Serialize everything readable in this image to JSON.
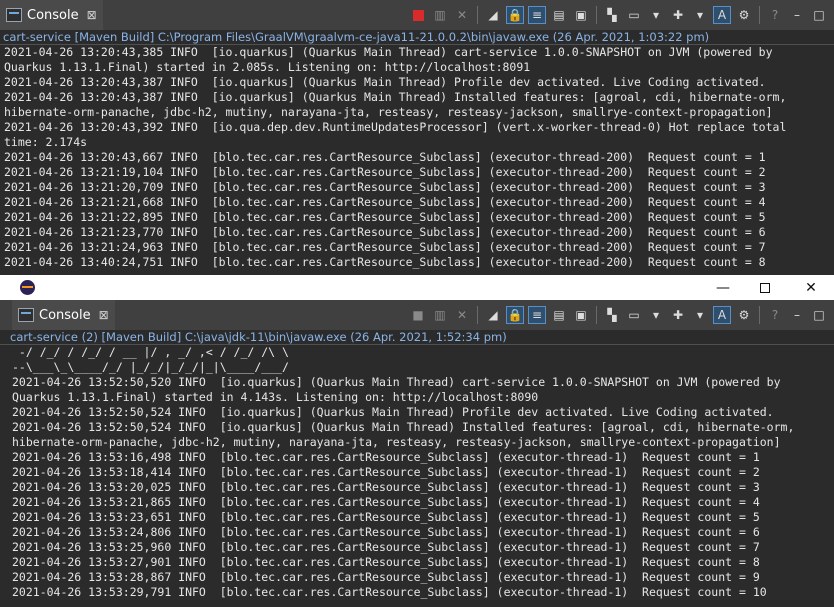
{
  "top_console": {
    "tab_label": "Console",
    "close_glyph": "⊠",
    "path": "cart-service [Maven Build] C:\\Program Files\\GraalVM\\graalvm-ce-java11-21.0.0.2\\bin\\javaw.exe  (26 Apr. 2021, 1:03:22 pm)",
    "lines": [
      "2021-04-26 13:20:43,385 INFO  [io.quarkus] (Quarkus Main Thread) cart-service 1.0.0-SNAPSHOT on JVM (powered by",
      "Quarkus 1.13.1.Final) started in 2.085s. Listening on: http://localhost:8091",
      "2021-04-26 13:20:43,387 INFO  [io.quarkus] (Quarkus Main Thread) Profile dev activated. Live Coding activated.",
      "2021-04-26 13:20:43,387 INFO  [io.quarkus] (Quarkus Main Thread) Installed features: [agroal, cdi, hibernate-orm,",
      "hibernate-orm-panache, jdbc-h2, mutiny, narayana-jta, resteasy, resteasy-jackson, smallrye-context-propagation]",
      "2021-04-26 13:20:43,392 INFO  [io.qua.dep.dev.RuntimeUpdatesProcessor] (vert.x-worker-thread-0) Hot replace total",
      "time: 2.174s",
      "2021-04-26 13:20:43,667 INFO  [blo.tec.car.res.CartResource_Subclass] (executor-thread-200)  Request count = 1",
      "2021-04-26 13:21:19,104 INFO  [blo.tec.car.res.CartResource_Subclass] (executor-thread-200)  Request count = 2",
      "2021-04-26 13:21:20,709 INFO  [blo.tec.car.res.CartResource_Subclass] (executor-thread-200)  Request count = 3",
      "2021-04-26 13:21:21,668 INFO  [blo.tec.car.res.CartResource_Subclass] (executor-thread-200)  Request count = 4",
      "2021-04-26 13:21:22,895 INFO  [blo.tec.car.res.CartResource_Subclass] (executor-thread-200)  Request count = 5",
      "2021-04-26 13:21:23,770 INFO  [blo.tec.car.res.CartResource_Subclass] (executor-thread-200)  Request count = 6",
      "2021-04-26 13:21:24,963 INFO  [blo.tec.car.res.CartResource_Subclass] (executor-thread-200)  Request count = 7",
      "2021-04-26 13:40:24,751 INFO  [blo.tec.car.res.CartResource_Subclass] (executor-thread-200)  Request count = 8"
    ]
  },
  "window_controls": {
    "minimize": "—",
    "close": "✕"
  },
  "bottom_console": {
    "tab_label": "Console",
    "close_glyph": "⊠",
    "path": "cart-service (2) [Maven Build] C:\\java\\jdk-11\\bin\\javaw.exe  (26 Apr. 2021, 1:52:34 pm)",
    "ascii_lines": [
      " -/ /_/ / /_/ / __ |/ , _/ ,< / /_/ /\\ \\",
      "--\\___\\_\\____/_/ |_/_/|_/_/|_|\\____/___/"
    ],
    "lines": [
      "2021-04-26 13:52:50,520 INFO  [io.quarkus] (Quarkus Main Thread) cart-service 1.0.0-SNAPSHOT on JVM (powered by",
      "Quarkus 1.13.1.Final) started in 4.143s. Listening on: http://localhost:8090",
      "2021-04-26 13:52:50,524 INFO  [io.quarkus] (Quarkus Main Thread) Profile dev activated. Live Coding activated.",
      "2021-04-26 13:52:50,524 INFO  [io.quarkus] (Quarkus Main Thread) Installed features: [agroal, cdi, hibernate-orm,",
      "hibernate-orm-panache, jdbc-h2, mutiny, narayana-jta, resteasy, resteasy-jackson, smallrye-context-propagation]",
      "2021-04-26 13:53:16,498 INFO  [blo.tec.car.res.CartResource_Subclass] (executor-thread-1)  Request count = 1",
      "2021-04-26 13:53:18,414 INFO  [blo.tec.car.res.CartResource_Subclass] (executor-thread-1)  Request count = 2",
      "2021-04-26 13:53:20,025 INFO  [blo.tec.car.res.CartResource_Subclass] (executor-thread-1)  Request count = 3",
      "2021-04-26 13:53:21,865 INFO  [blo.tec.car.res.CartResource_Subclass] (executor-thread-1)  Request count = 4",
      "2021-04-26 13:53:23,651 INFO  [blo.tec.car.res.CartResource_Subclass] (executor-thread-1)  Request count = 5",
      "2021-04-26 13:53:24,806 INFO  [blo.tec.car.res.CartResource_Subclass] (executor-thread-1)  Request count = 6",
      "2021-04-26 13:53:25,960 INFO  [blo.tec.car.res.CartResource_Subclass] (executor-thread-1)  Request count = 7",
      "2021-04-26 13:53:27,901 INFO  [blo.tec.car.res.CartResource_Subclass] (executor-thread-1)  Request count = 8",
      "2021-04-26 13:53:28,867 INFO  [blo.tec.car.res.CartResource_Subclass] (executor-thread-1)  Request count = 9",
      "2021-04-26 13:53:29,791 INFO  [blo.tec.car.res.CartResource_Subclass] (executor-thread-1)  Request count = 10"
    ]
  },
  "toolbar_icons": [
    "terminate-icon",
    "remove-launch-icon",
    "remove-all-terminated-icon",
    "clear-console-icon",
    "scroll-lock-icon",
    "word-wrap-icon",
    "show-on-stdout-icon",
    "show-on-stderr-icon",
    "pin-console-icon",
    "display-selected-console-icon",
    "open-console-icon",
    "link-icon",
    "settings-icon",
    "help-icon",
    "minimize-view-icon",
    "maximize-view-icon"
  ],
  "colors": {
    "path_link": "#89b4e8",
    "terminate": "#d92b2b",
    "background": "#2b2b2b",
    "toolbar": "#404040"
  }
}
